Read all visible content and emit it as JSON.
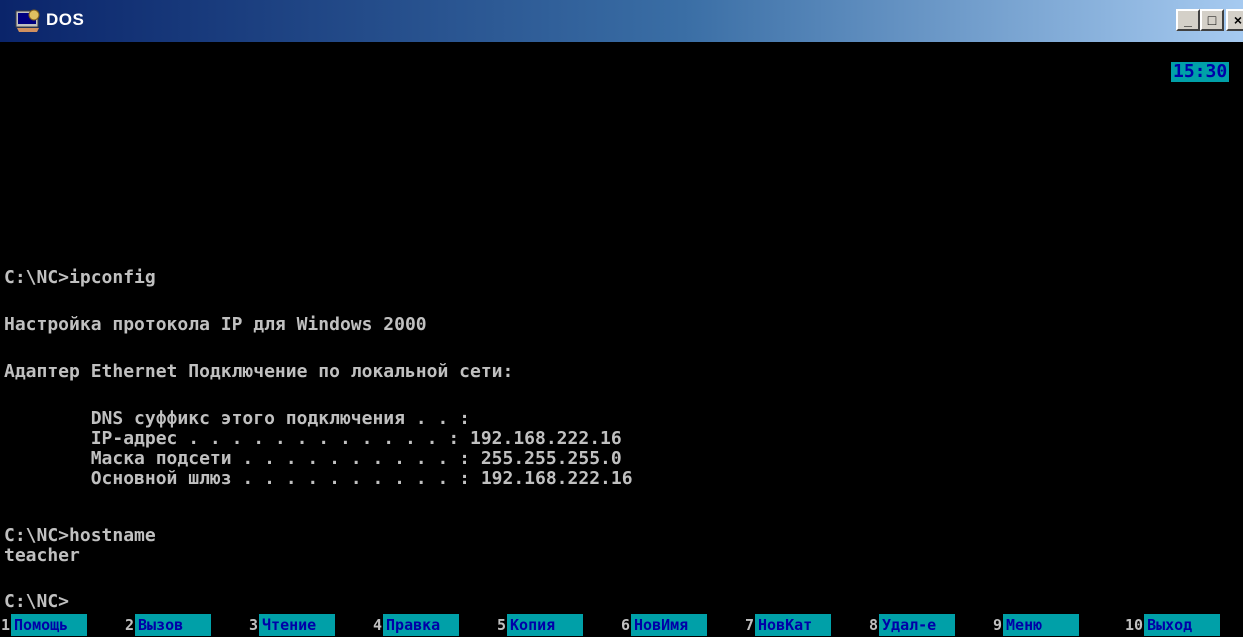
{
  "window": {
    "title": "DOS",
    "controls": {
      "minimize": "_",
      "maximize": "□",
      "close": "×"
    }
  },
  "clock": "15:30",
  "console_lines": [
    "C:\\NC>ipconfig",
    "Настройка протокола IP для Windows 2000",
    "Адаптер Ethernet Подключение по локальной сети:",
    "        DNS суффикс этого подключения . . :",
    "        IP-адрес . . . . . . . . . . . . : 192.168.222.16",
    "        Маска подсети . . . . . . . . . . : 255.255.255.0",
    "        Основной шлюз . . . . . . . . . . : 192.168.222.16",
    "C:\\NC>hostname",
    "teacher",
    "C:\\NC>"
  ],
  "keybar": [
    {
      "num": "1",
      "label": "Помощь"
    },
    {
      "num": "2",
      "label": "Вызов"
    },
    {
      "num": "3",
      "label": "Чтение"
    },
    {
      "num": "4",
      "label": "Правка"
    },
    {
      "num": "5",
      "label": "Копия"
    },
    {
      "num": "6",
      "label": "НовИмя"
    },
    {
      "num": "7",
      "label": "НовКат"
    },
    {
      "num": "8",
      "label": "Удал-е"
    },
    {
      "num": "9",
      "label": "Меню"
    },
    {
      "num": "10",
      "label": "Выход"
    }
  ],
  "colors": {
    "console_bg": "#000000",
    "console_text": "#c0c0c0",
    "keybar_label_bg": "#00a0a8",
    "keybar_label_text": "#0000a8"
  }
}
